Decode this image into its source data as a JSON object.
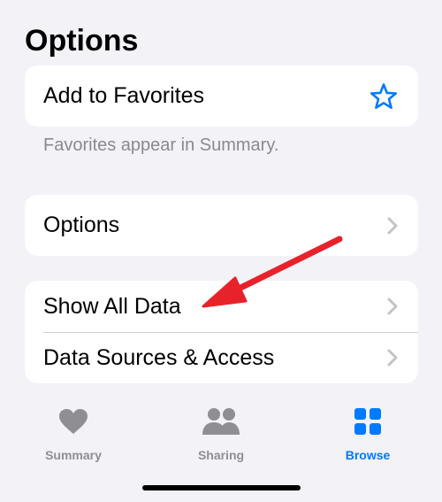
{
  "section": {
    "title": "Options"
  },
  "favorites": {
    "label": "Add to Favorites",
    "footer": "Favorites appear in Summary."
  },
  "options_row": {
    "label": "Options"
  },
  "data_rows": [
    {
      "label": "Show All Data"
    },
    {
      "label": "Data Sources & Access"
    }
  ],
  "tabs": [
    {
      "label": "Summary",
      "icon": "heart-icon",
      "color": "#8e8e93"
    },
    {
      "label": "Sharing",
      "icon": "people-icon",
      "color": "#8e8e93"
    },
    {
      "label": "Browse",
      "icon": "grid-icon",
      "color": "#007aff",
      "selected": true
    }
  ],
  "colors": {
    "accent": "#007aff",
    "annotation_arrow": "#e8222b",
    "background": "#f2f2f7"
  }
}
